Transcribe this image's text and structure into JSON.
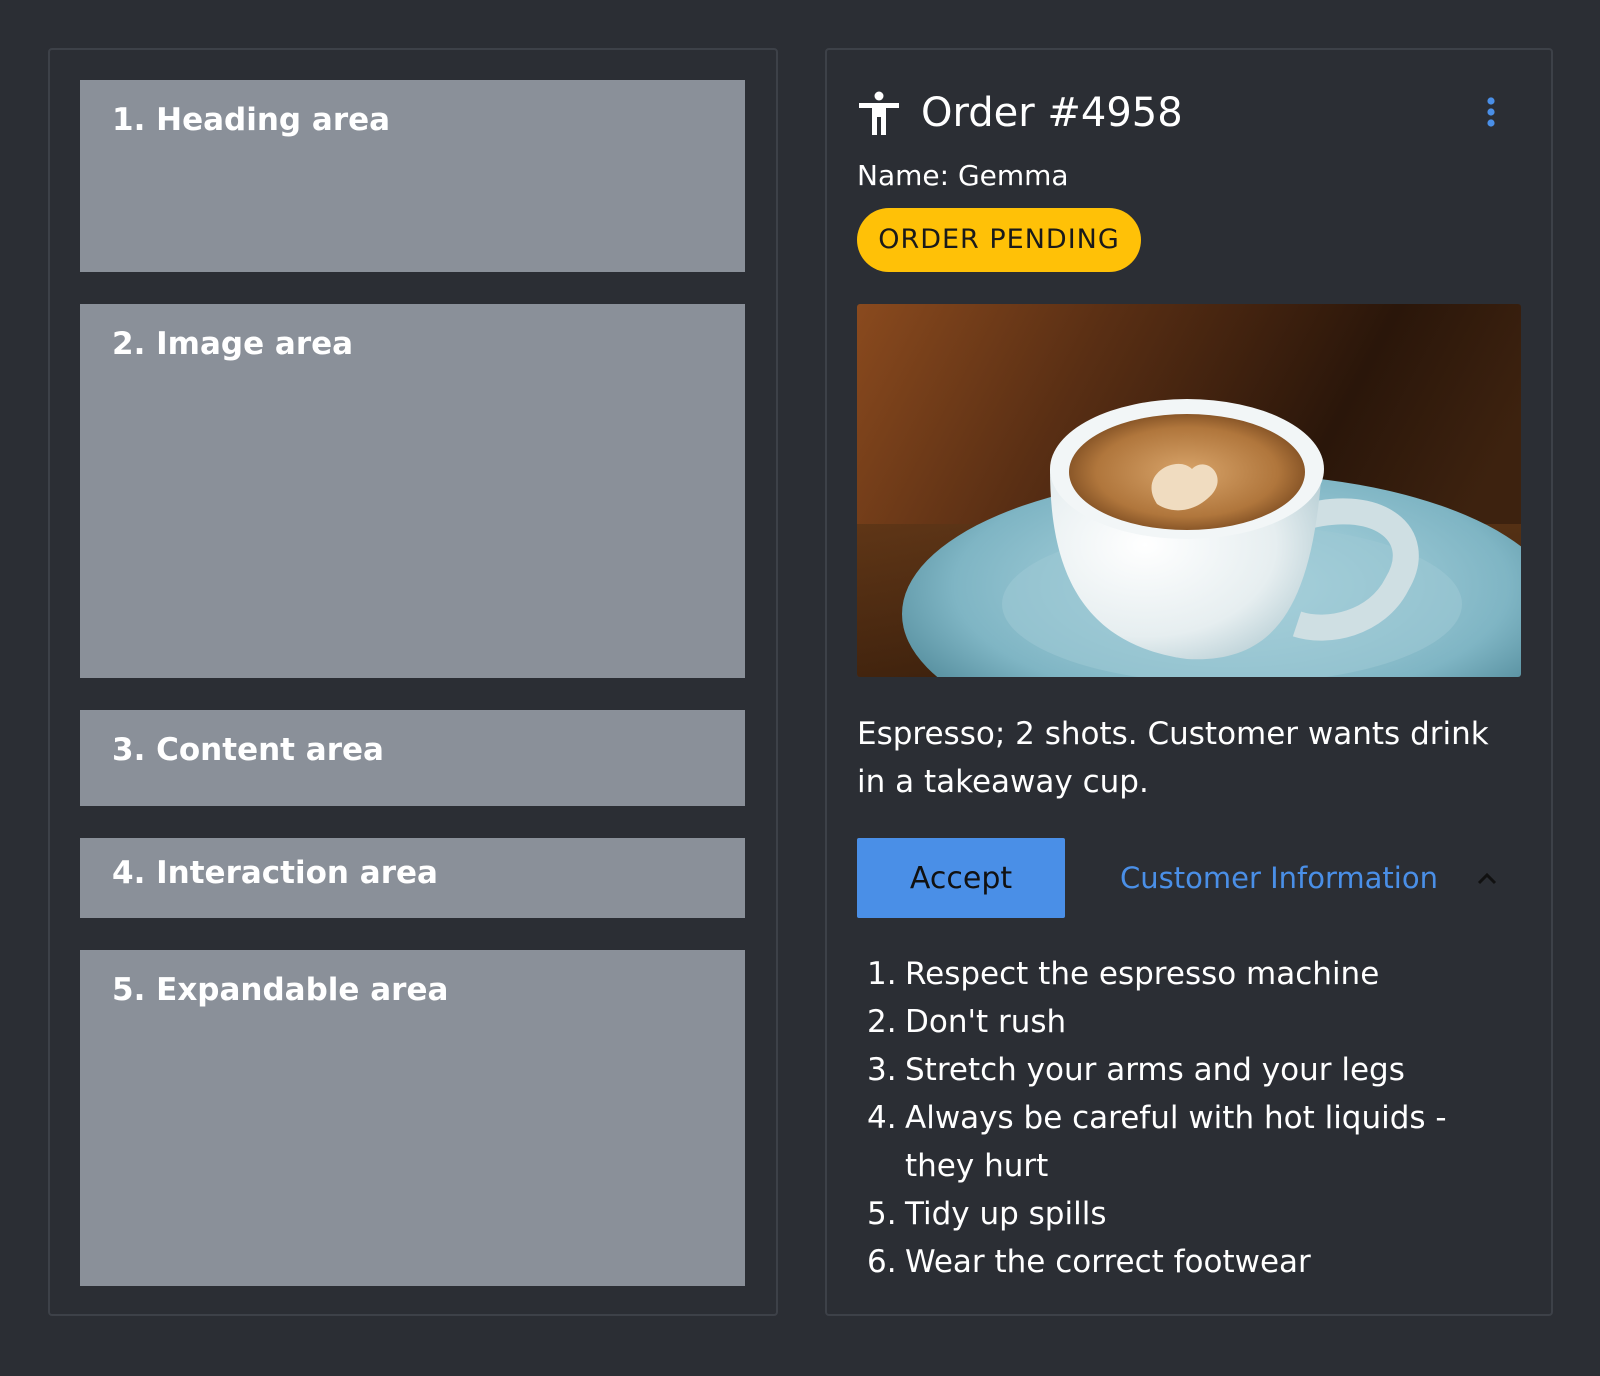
{
  "layout_legend": {
    "areas": [
      {
        "label": "1. Heading area"
      },
      {
        "label": "2. Image area"
      },
      {
        "label": "3. Content area"
      },
      {
        "label": "4. Interaction area"
      },
      {
        "label": "5. Expandable area"
      }
    ]
  },
  "card": {
    "title": "Order #4958",
    "customer_name": "Name: Gemma",
    "status": "ORDER PENDING",
    "image_icon": "espresso-cup-photo",
    "description": "Espresso; 2 shots. Customer wants drink in a takeaway cup.",
    "accept_label": "Accept",
    "toggle_label": "Customer Information",
    "rules": [
      {
        "num": "1.",
        "text": "Respect the espresso machine"
      },
      {
        "num": "2.",
        "text": "Don't rush"
      },
      {
        "num": "3.",
        "text": "Stretch your arms and your legs"
      },
      {
        "num": "4.",
        "text": "Always be careful with hot liquids - they hurt"
      },
      {
        "num": "5.",
        "text": "Tidy up spills"
      },
      {
        "num": "6.",
        "text": "Wear the correct footwear"
      }
    ]
  },
  "icons": {
    "heading_icon": "person-icon",
    "menu_icon": "more-vertical-icon",
    "toggle_icon": "chevron-up-icon"
  },
  "colors": {
    "background": "#2b2e34",
    "placeholder": "#8a9099",
    "accent": "#4a8fe7",
    "badge": "#ffc107"
  }
}
